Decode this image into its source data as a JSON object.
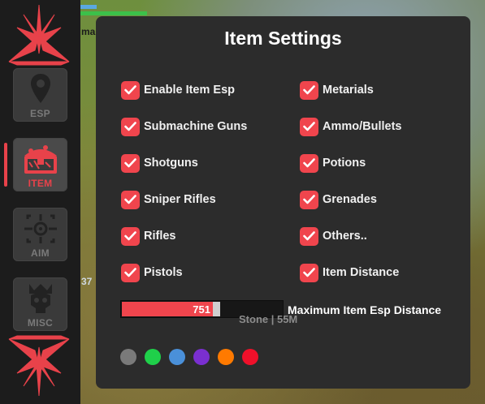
{
  "background": {
    "hud_text_top": "ma",
    "hud_text_mid": "37"
  },
  "sidebar": {
    "items": [
      {
        "label": "ESP",
        "icon": "map-pin-icon",
        "active": false
      },
      {
        "label": "ITEM",
        "icon": "treasure-chest-icon",
        "active": true
      },
      {
        "label": "AIM",
        "icon": "crosshair-icon",
        "active": false
      },
      {
        "label": "MISC",
        "icon": "skull-crown-icon",
        "active": false
      }
    ],
    "accent": "#e8424a"
  },
  "panel": {
    "title": "Item Settings",
    "options_left": [
      {
        "label": "Enable Item Esp",
        "checked": true
      },
      {
        "label": "Submachine Guns",
        "checked": true
      },
      {
        "label": "Shotguns",
        "checked": true
      },
      {
        "label": "Sniper Rifles",
        "checked": true
      },
      {
        "label": "Rifles",
        "checked": true
      },
      {
        "label": "Pistols",
        "checked": true
      }
    ],
    "options_right": [
      {
        "label": "Metarials",
        "checked": true
      },
      {
        "label": "Ammo/Bullets",
        "checked": true
      },
      {
        "label": "Potions",
        "checked": true
      },
      {
        "label": "Grenades",
        "checked": true
      },
      {
        "label": "Others..",
        "checked": true
      },
      {
        "label": "Item Distance",
        "checked": true
      }
    ],
    "slider": {
      "value": "751",
      "fill_fraction": 0.56,
      "label": "Maximum Item Esp Distance"
    },
    "overlay_text": "Stone | 55M",
    "color_swatches": [
      "#7a7a7a",
      "#1fd04a",
      "#4a90d9",
      "#7a2fd0",
      "#ff7a00",
      "#f0102a"
    ]
  }
}
